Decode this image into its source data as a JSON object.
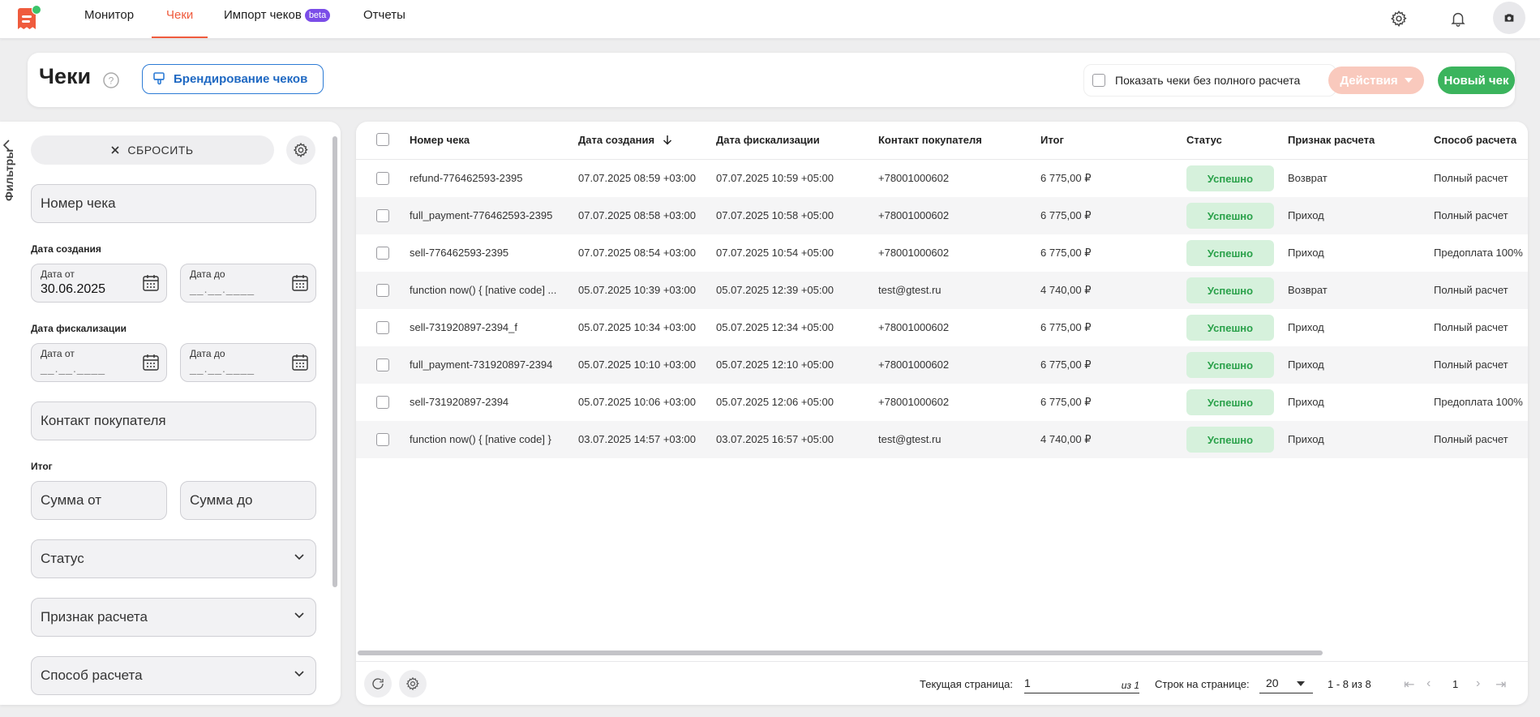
{
  "nav": {
    "tabs": [
      {
        "label": "Монитор"
      },
      {
        "label": "Чеки",
        "active": true
      },
      {
        "label": "Импорт чеков",
        "badge": "beta"
      },
      {
        "label": "Отчеты"
      }
    ],
    "icons": [
      "gear-icon",
      "bell-icon",
      "camera-avatar-icon"
    ]
  },
  "header": {
    "title": "Чеки",
    "brand_button": "Брендирование чеков",
    "show_incomplete_label": "Показать чеки без полного расчета",
    "actions_button": "Действия",
    "new_button": "Новый чек"
  },
  "filters": {
    "side_label": "Фильтры",
    "reset_button": "СБРОСИТЬ",
    "check_number_placeholder": "Номер чека",
    "created_label": "Дата создания",
    "date_from_label": "Дата от",
    "date_to_label": "Дата до",
    "created_from_value": "30.06.2025",
    "date_mask": "__.__.____",
    "fiscal_label": "Дата фискализации",
    "contact_placeholder": "Контакт покупателя",
    "total_label": "Итог",
    "sum_from_placeholder": "Сумма от",
    "sum_to_placeholder": "Сумма до",
    "status_placeholder": "Статус",
    "payment_sign_placeholder": "Признак расчета",
    "payment_method_placeholder": "Способ расчета"
  },
  "table": {
    "columns": [
      "Номер чека",
      "Дата создания",
      "Дата фискализации",
      "Контакт покупателя",
      "Итог",
      "Статус",
      "Признак расчета",
      "Способ расчета"
    ],
    "rows": [
      {
        "number": "refund-776462593-2395",
        "created": "07.07.2025 08:59 +03:00",
        "fiscal": "07.07.2025 10:59 +05:00",
        "contact": "+78001000602",
        "total": "6 775,00 ₽",
        "status": "Успешно",
        "sign": "Возврат",
        "method": "Полный расчет"
      },
      {
        "number": "full_payment-776462593-2395",
        "created": "07.07.2025 08:58 +03:00",
        "fiscal": "07.07.2025 10:58 +05:00",
        "contact": "+78001000602",
        "total": "6 775,00 ₽",
        "status": "Успешно",
        "sign": "Приход",
        "method": "Полный расчет"
      },
      {
        "number": "sell-776462593-2395",
        "created": "07.07.2025 08:54 +03:00",
        "fiscal": "07.07.2025 10:54 +05:00",
        "contact": "+78001000602",
        "total": "6 775,00 ₽",
        "status": "Успешно",
        "sign": "Приход",
        "method": "Предоплата 100%"
      },
      {
        "number": "function now() { [native code] ...",
        "created": "05.07.2025 10:39 +03:00",
        "fiscal": "05.07.2025 12:39 +05:00",
        "contact": "test@gtest.ru",
        "total": "4 740,00 ₽",
        "status": "Успешно",
        "sign": "Возврат",
        "method": "Полный расчет"
      },
      {
        "number": "sell-731920897-2394_f",
        "created": "05.07.2025 10:34 +03:00",
        "fiscal": "05.07.2025 12:34 +05:00",
        "contact": "+78001000602",
        "total": "6 775,00 ₽",
        "status": "Успешно",
        "sign": "Приход",
        "method": "Полный расчет"
      },
      {
        "number": "full_payment-731920897-2394",
        "created": "05.07.2025 10:10 +03:00",
        "fiscal": "05.07.2025 12:10 +05:00",
        "contact": "+78001000602",
        "total": "6 775,00 ₽",
        "status": "Успешно",
        "sign": "Приход",
        "method": "Полный расчет"
      },
      {
        "number": "sell-731920897-2394",
        "created": "05.07.2025 10:06 +03:00",
        "fiscal": "05.07.2025 12:06 +05:00",
        "contact": "+78001000602",
        "total": "6 775,00 ₽",
        "status": "Успешно",
        "sign": "Приход",
        "method": "Предоплата 100%"
      },
      {
        "number": "function now() { [native code] }",
        "created": "03.07.2025 14:57 +03:00",
        "fiscal": "03.07.2025 16:57 +05:00",
        "contact": "test@gtest.ru",
        "total": "4 740,00 ₽",
        "status": "Успешно",
        "sign": "Приход",
        "method": "Полный расчет"
      }
    ]
  },
  "pagination": {
    "current_page_label": "Текущая страница:",
    "current_page": "1",
    "of_pages": "из 1",
    "rows_per_page_label": "Строк на странице:",
    "rows_per_page": "20",
    "range": "1 - 8 из 8",
    "page_number": "1"
  },
  "colors": {
    "accent": "#ef5b3d",
    "primary_blue": "#2c7bd5",
    "success_green": "#3bb45d",
    "beta_purple": "#7b4de8"
  }
}
